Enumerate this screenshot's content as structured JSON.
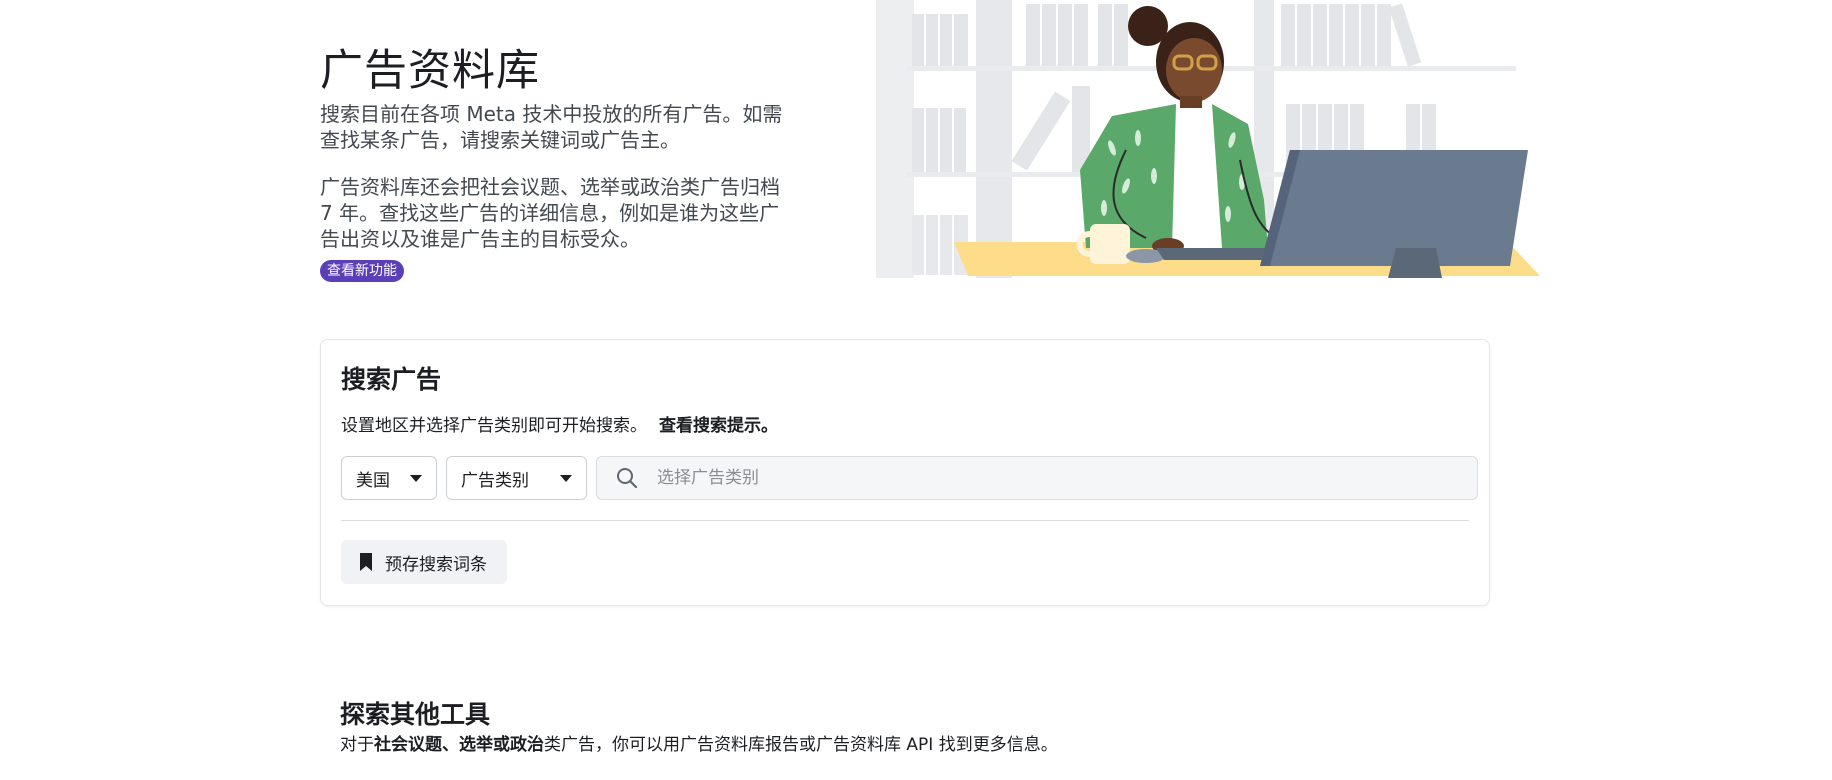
{
  "hero": {
    "title": "广告资料库",
    "description1": "搜索目前在各项 Meta 技术中投放的所有广告。如需查找某条广告，请搜索关键词或广告主。",
    "description2": "广告资料库还会把社会议题、选举或政治类广告归档 7 年。查找这些广告的详细信息，例如是谁为这些广告出资以及谁是广告主的目标受众。",
    "badge": "查看新功能"
  },
  "search": {
    "title": "搜索广告",
    "hint": "设置地区并选择广告类别即可开始搜索。",
    "hint_link": "查看搜索提示。",
    "country": "美国",
    "category": "广告类别",
    "placeholder": "选择广告类别",
    "saved_searches": "预存搜索词条"
  },
  "explore": {
    "title": "探索其他工具",
    "desc_prefix": "对于",
    "desc_bold": "社会议题、选举或政治",
    "desc_suffix": "类广告，你可以用广告资料库报告或广告资料库 API 找到更多信息。"
  },
  "colors": {
    "badge": "#5b3fb8",
    "sweater": "#5aa86a",
    "desk": "#fddc8a",
    "monitor": "#6b7b8f"
  }
}
